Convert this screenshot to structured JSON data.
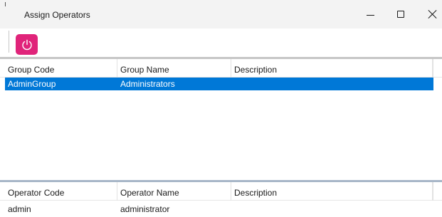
{
  "window": {
    "title": "Assign Operators"
  },
  "toolbar": {
    "power_icon": "power-icon",
    "power_color": "#e0247a"
  },
  "groups_grid": {
    "columns": [
      "Group Code",
      "Group Name",
      "Description"
    ],
    "rows": [
      {
        "code": "AdminGroup",
        "name": "Administrators",
        "description": "",
        "selected": true
      }
    ],
    "selection_color": "#0078d7"
  },
  "operators_grid": {
    "columns": [
      "Operator Code",
      "Operator Name",
      "Description"
    ],
    "rows": [
      {
        "code": "admin",
        "name": "administrator",
        "description": ""
      }
    ]
  }
}
